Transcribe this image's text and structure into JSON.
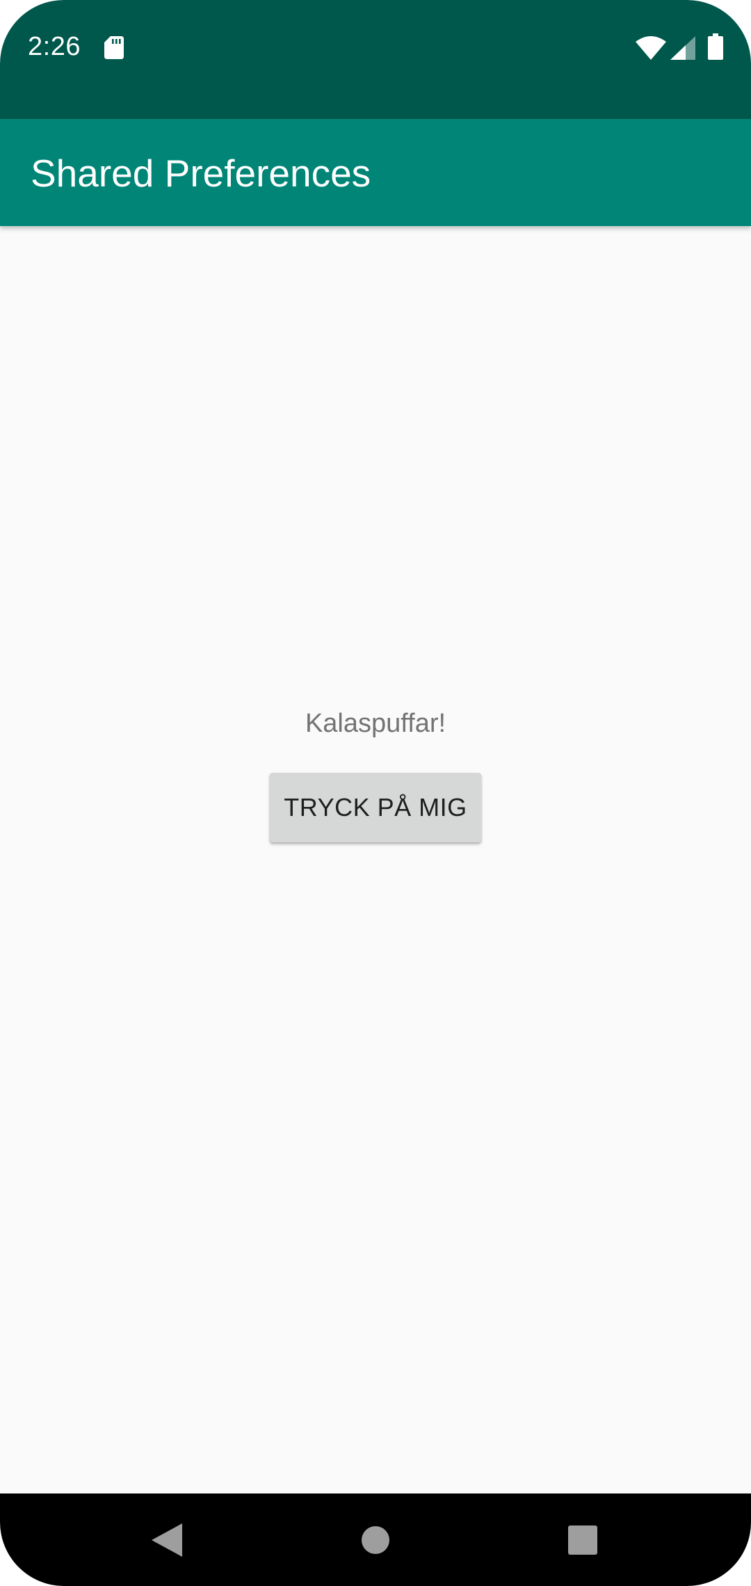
{
  "status_bar": {
    "time": "2:26",
    "icons": [
      "sd-card-icon",
      "wifi-icon",
      "cell-signal-icon",
      "battery-icon"
    ]
  },
  "app_bar": {
    "title": "Shared Preferences"
  },
  "main": {
    "message": "Kalaspuffar!",
    "button_label": "TRYCK PÅ MIG"
  },
  "nav_bar": {
    "icons": [
      "back-icon",
      "home-icon",
      "recents-icon"
    ]
  },
  "colors": {
    "status_bar": "#00574b",
    "app_bar": "#008577",
    "background": "#fafafa",
    "button": "#d6d7d7",
    "nav_bar": "#000000"
  }
}
